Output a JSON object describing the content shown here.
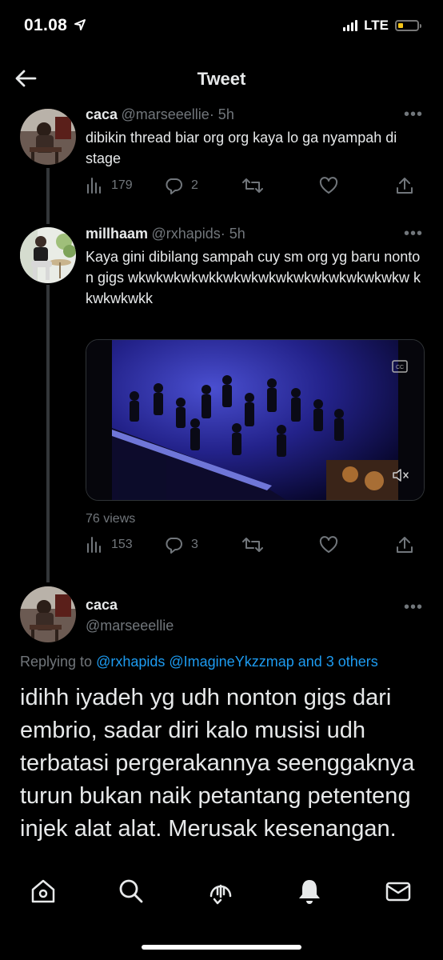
{
  "status_bar": {
    "time": "01.08",
    "network": "LTE",
    "battery_level": 0.25
  },
  "header": {
    "title": "Tweet"
  },
  "tweets": [
    {
      "name": "caca",
      "handle": "@marseeellie",
      "time": "· 5h",
      "text": "dibikin thread biar org org kaya lo ga nyampah di stage",
      "views": "179",
      "replies": "2",
      "retweets": "",
      "likes": ""
    },
    {
      "name": "millhaam",
      "handle": "@rxhapids",
      "time": "· 5h",
      "text": "Kaya gini dibilang sampah cuy sm org yg baru nonton gigs wkwkwkwkwkkwkwkwkwkwkwkwkwkwkwkw kkwkwkwkk",
      "view_count_label": "76 views",
      "views": "153",
      "replies": "3",
      "retweets": "",
      "likes": ""
    }
  ],
  "main_tweet": {
    "name": "caca",
    "handle": "@marseeellie",
    "replying_prefix": "Replying to",
    "replying_to": "@rxhapids @ImagineYkzzmap and 3 others",
    "text": "idihh iyadeh yg udh nonton gigs dari embrio, sadar diri kalo musisi udh terbatasi pergerakannya seenggaknya turun bukan naik petantang petenteng injek alat alat. Merusak kesenangan."
  },
  "bottom_nav": {
    "items": [
      "home-icon",
      "search-icon",
      "spaces-icon",
      "notifications-icon",
      "messages-icon"
    ]
  },
  "colors": {
    "background": "#000000",
    "link": "#1d9bf0",
    "muted": "#71767b",
    "text": "#e7e9ea"
  }
}
